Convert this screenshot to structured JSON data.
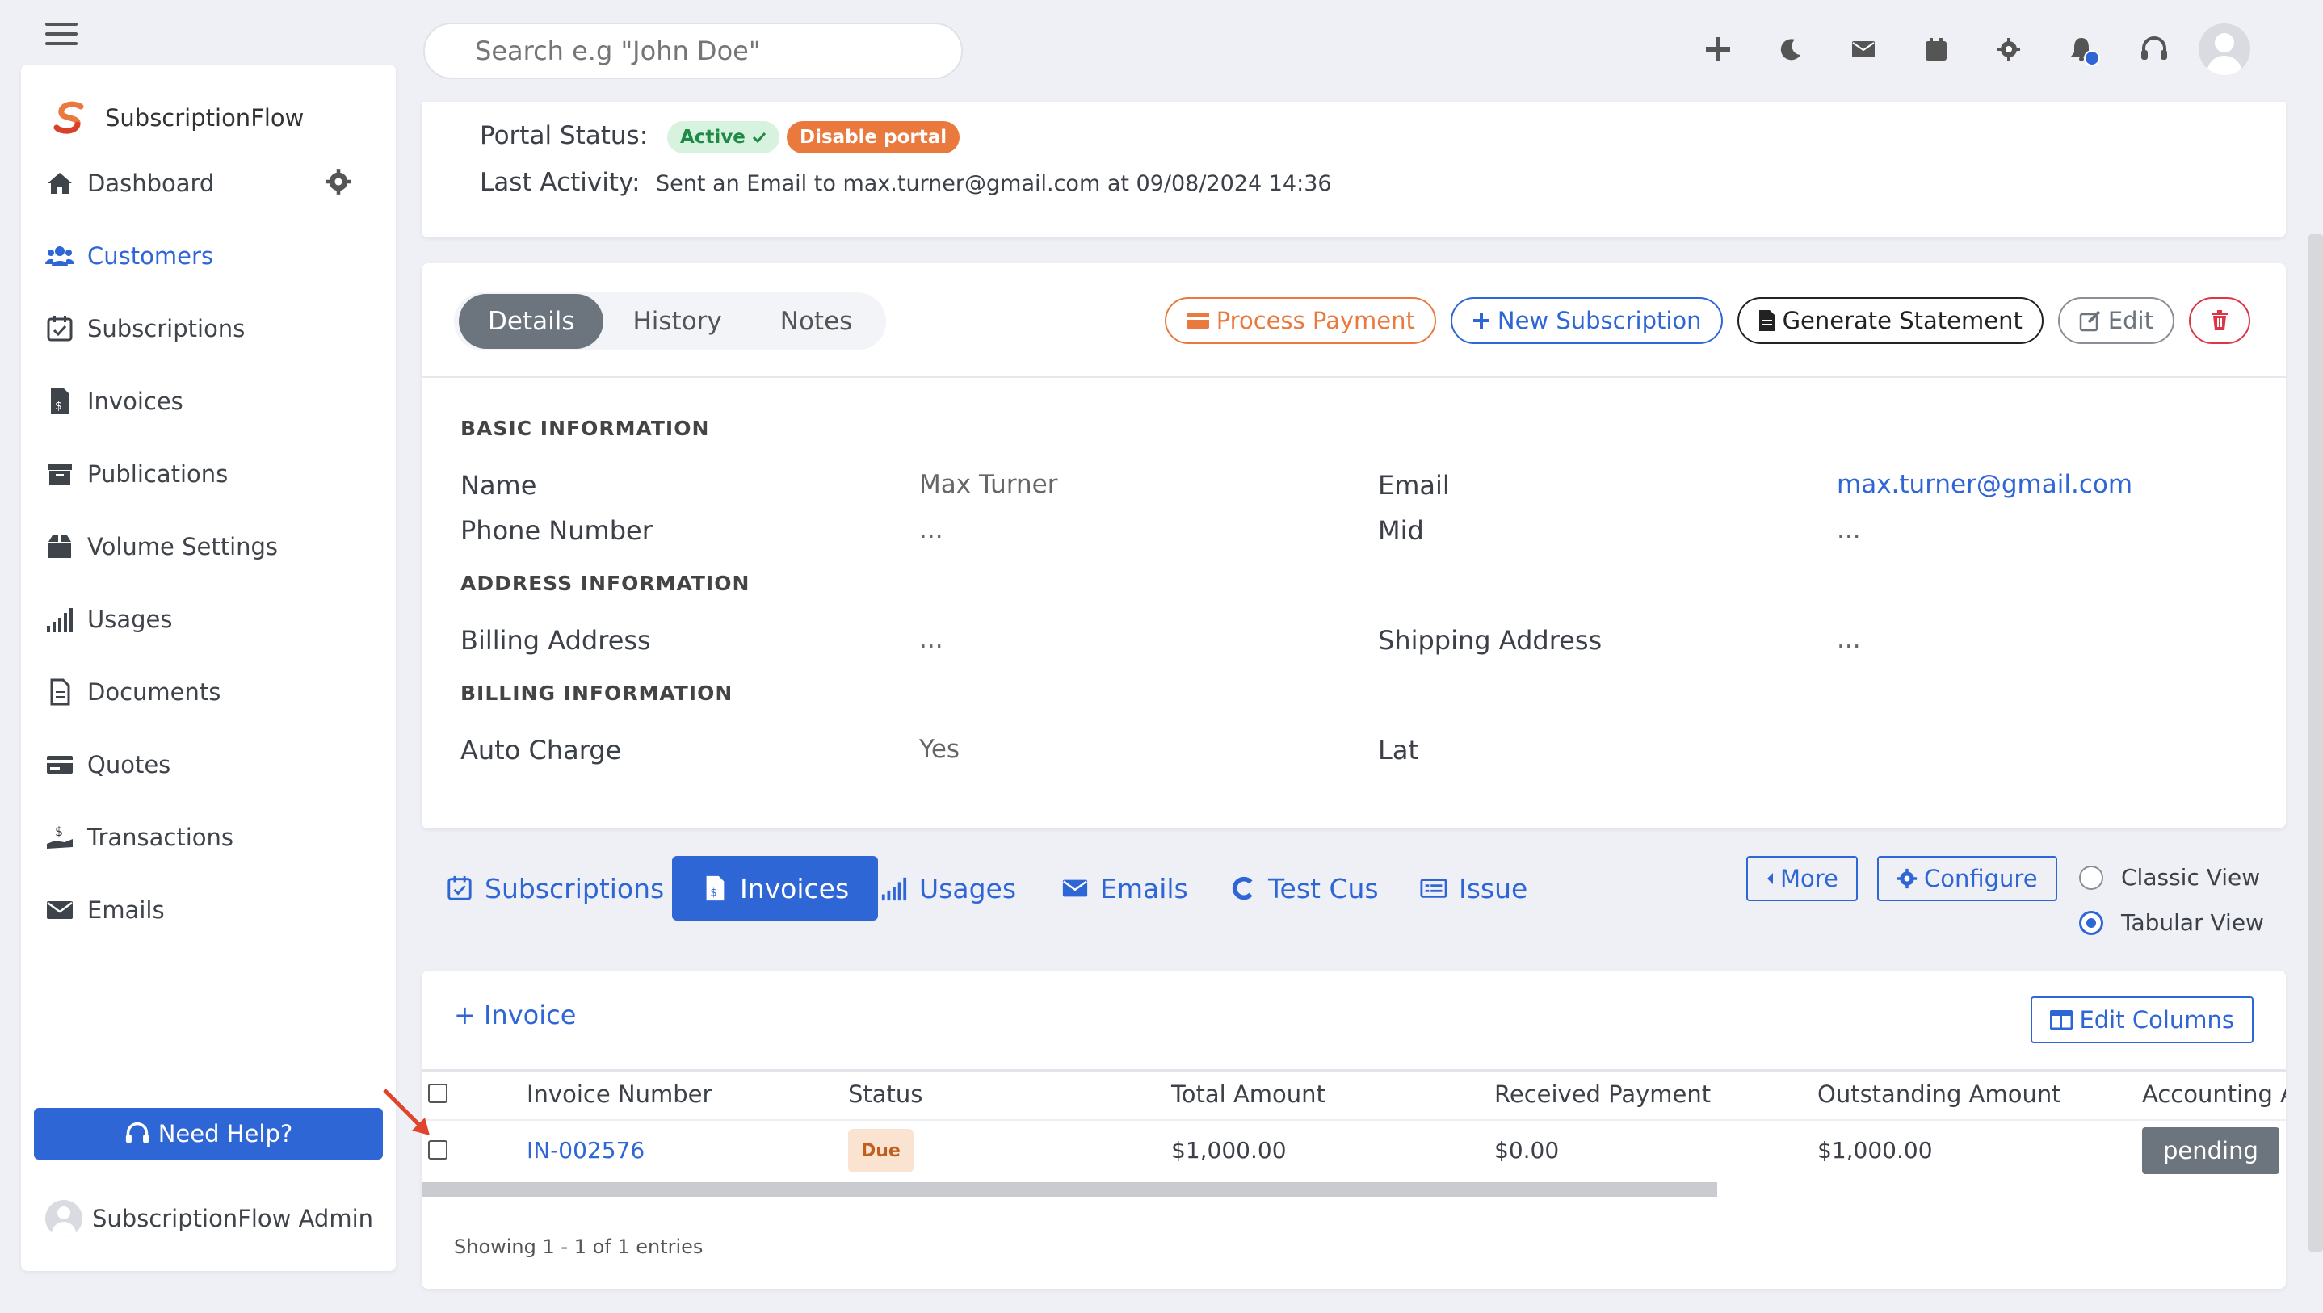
{
  "topbar": {
    "search_placeholder": "Search e.g \"John Doe\""
  },
  "sidebar": {
    "brand": "SubscriptionFlow",
    "items": [
      {
        "label": "Dashboard",
        "icon": "home-icon"
      },
      {
        "label": "Customers",
        "icon": "users-icon"
      },
      {
        "label": "Subscriptions",
        "icon": "calendar-check-icon"
      },
      {
        "label": "Invoices",
        "icon": "invoice-icon"
      },
      {
        "label": "Publications",
        "icon": "archive-icon"
      },
      {
        "label": "Volume Settings",
        "icon": "box-icon"
      },
      {
        "label": "Usages",
        "icon": "signal-bars-icon"
      },
      {
        "label": "Documents",
        "icon": "document-icon"
      },
      {
        "label": "Quotes",
        "icon": "card-icon"
      },
      {
        "label": "Transactions",
        "icon": "hand-dollar-icon"
      },
      {
        "label": "Emails",
        "icon": "envelope-icon"
      }
    ],
    "need_help": "Need Help?",
    "admin_name": "SubscriptionFlow Admin"
  },
  "portal": {
    "status_label": "Portal Status:",
    "active_badge": "Active",
    "disable_button": "Disable portal",
    "activity_label": "Last Activity:",
    "activity_text": "Sent an Email to max.turner@gmail.com at 09/08/2024 14:36"
  },
  "details": {
    "tabs": [
      "Details",
      "History",
      "Notes"
    ],
    "actions": {
      "process_payment": "Process Payment",
      "new_subscription": "New Subscription",
      "generate_statement": "Generate Statement",
      "edit": "Edit"
    },
    "sections": {
      "basic": "BASIC INFORMATION",
      "address": "ADDRESS INFORMATION",
      "billing": "BILLING INFORMATION"
    },
    "fields": {
      "name_label": "Name",
      "name_value": "Max Turner",
      "email_label": "Email",
      "email_value": "max.turner@gmail.com",
      "phone_label": "Phone Number",
      "phone_value": "...",
      "mid_label": "Mid",
      "mid_value": "...",
      "billing_addr_label": "Billing Address",
      "billing_addr_value": "...",
      "shipping_addr_label": "Shipping Address",
      "shipping_addr_value": "...",
      "auto_charge_label": "Auto Charge",
      "auto_charge_value": "Yes",
      "lat_label": "Lat"
    }
  },
  "lower_tabs": {
    "subscriptions": "Subscriptions",
    "invoices": "Invoices",
    "usages": "Usages",
    "emails": "Emails",
    "test_cus": "Test Cus",
    "issue": "Issue",
    "more": "More",
    "configure": "Configure",
    "classic_view": "Classic View",
    "tabular_view": "Tabular View",
    "selected_view": "Tabular View"
  },
  "invoices_table": {
    "add_label": "+ Invoice",
    "edit_columns": "Edit Columns",
    "headers": [
      "Invoice Number",
      "Status",
      "Total Amount",
      "Received Payment",
      "Outstanding Amount",
      "Accounting A"
    ],
    "rows": [
      {
        "invoice_number": "IN-002576",
        "status": "Due",
        "total": "$1,000.00",
        "received": "$0.00",
        "outstanding": "$1,000.00",
        "accounting": "pending"
      }
    ],
    "showing": "Showing 1 - 1 of 1 entries"
  },
  "colors": {
    "primary": "#2f66d6",
    "orange": "#e9793d",
    "danger": "#dc3545",
    "secondary": "#6c757d"
  }
}
